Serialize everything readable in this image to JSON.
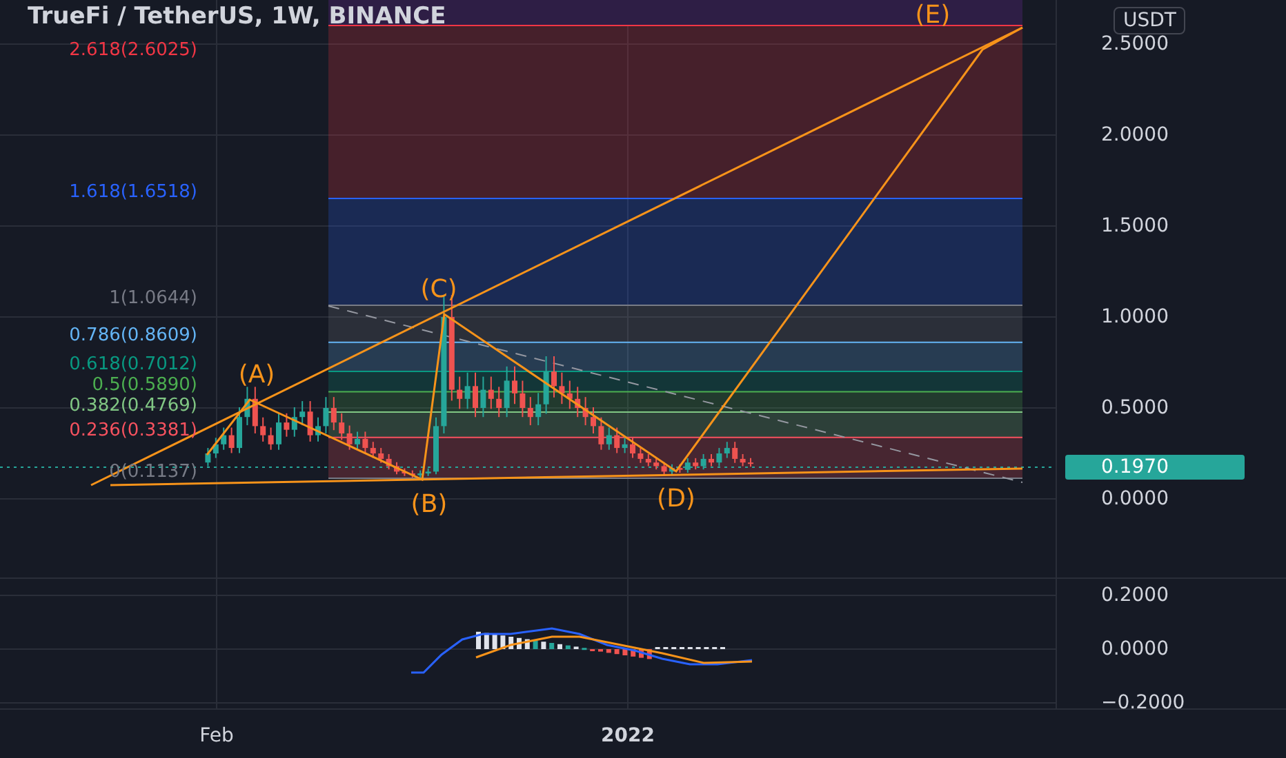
{
  "title": "TrueFi / TetherUS, 1W, BINANCE",
  "currency": "USDT",
  "fib_levels": [
    {
      "label": "2.618(2.6025)",
      "color": "#f23645"
    },
    {
      "label": "1.618(1.6518)",
      "color": "#2962ff"
    },
    {
      "label": "1(1.0644)",
      "color": "#787b86"
    },
    {
      "label": "0.786(0.8609)",
      "color": "#64b5f6"
    },
    {
      "label": "0.618(0.7012)",
      "color": "#089981"
    },
    {
      "label": "0.5(0.5890)",
      "color": "#4caf50"
    },
    {
      "label": "0.382(0.4769)",
      "color": "#81c784"
    },
    {
      "label": "0.236(0.3381)",
      "color": "#f7525f"
    },
    {
      "label": "0(0.1137)",
      "color": "#787b86"
    }
  ],
  "wave_labels": [
    "(A)",
    "(B)",
    "(C)",
    "(D)",
    "(E)"
  ],
  "price_ticks": [
    "2.5000",
    "2.0000",
    "1.5000",
    "1.0000",
    "0.5000",
    "0.0000"
  ],
  "last_price": "0.1970",
  "macd_ticks": [
    "0.2000",
    "0.0000",
    "−0.2000"
  ],
  "time_labels": [
    "Feb",
    "2022"
  ]
}
